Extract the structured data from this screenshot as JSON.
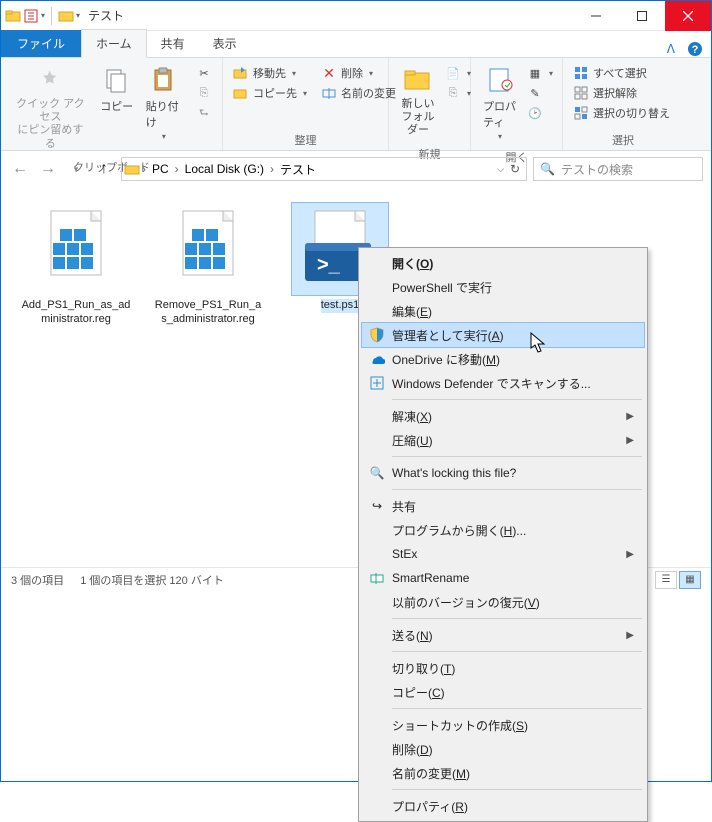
{
  "window": {
    "title": "テスト"
  },
  "tabs": {
    "file": "ファイル",
    "home": "ホーム",
    "share": "共有",
    "view": "表示"
  },
  "ribbon": {
    "clipboard": {
      "pin": "クイック アクセス\nにピン留めする",
      "copy": "コピー",
      "paste": "貼り付け",
      "cut": "切り取り",
      "copypath": "パスのコピー",
      "pasteshortcut": "ショートカットの貼り付け",
      "label": "クリップボード"
    },
    "organize": {
      "moveto": "移動先",
      "copyto": "コピー先",
      "delete": "削除",
      "rename": "名前の変更",
      "label": "整理"
    },
    "new": {
      "newfolder": "新しい\nフォルダー",
      "label": "新規"
    },
    "open": {
      "properties": "プロパティ",
      "label": "開く"
    },
    "select": {
      "selectall": "すべて選択",
      "selectnone": "選択解除",
      "invert": "選択の切り替え",
      "label": "選択"
    }
  },
  "breadcrumb": {
    "pc": "PC",
    "drive": "Local Disk (G:)",
    "folder": "テスト"
  },
  "search": {
    "placeholder": "テストの検索"
  },
  "files": [
    {
      "name": "Add_PS1_Run_as_administrator.reg"
    },
    {
      "name": "Remove_PS1_Run_as_administrator.reg"
    },
    {
      "name": "test.ps1"
    }
  ],
  "status": {
    "count": "3 個の項目",
    "selection": "1 個の項目を選択 120 バイト"
  },
  "context": {
    "open": "開く(O)",
    "runps": "PowerShell で実行",
    "edit": "編集(E)",
    "runas": "管理者として実行(A)",
    "onedrive": "OneDrive に移動(M)",
    "defender": "Windows Defender でスキャンする...",
    "extract": "解凍(X)",
    "compress": "圧縮(U)",
    "lock": "What's locking this file?",
    "share": "共有",
    "openwith": "プログラムから開く(H)...",
    "stex": "StEx",
    "smartrename": "SmartRename",
    "prev": "以前のバージョンの復元(V)",
    "sendto": "送る(N)",
    "cut": "切り取り(T)",
    "copy": "コピー(C)",
    "shortcut": "ショートカットの作成(S)",
    "delete": "削除(D)",
    "rename": "名前の変更(M)",
    "properties": "プロパティ(R)"
  }
}
